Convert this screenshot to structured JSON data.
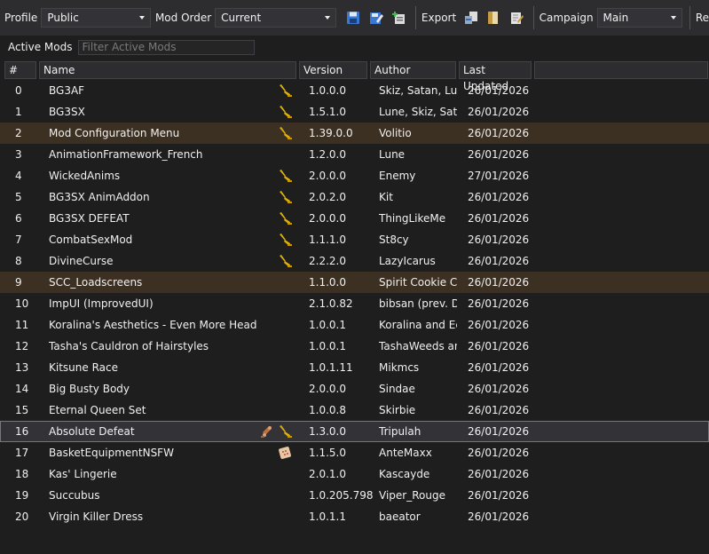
{
  "toolbar": {
    "profile_label": "Profile",
    "profile_value": "Public",
    "modorder_label": "Mod Order",
    "modorder_value": "Current",
    "export_label": "Export",
    "campaign_label": "Campaign",
    "campaign_value": "Main",
    "cutoff_label": "Re"
  },
  "filter": {
    "label": "Active Mods",
    "placeholder": "Filter Active Mods"
  },
  "columns": {
    "idx": "#",
    "name": "Name",
    "version": "Version",
    "author": "Author",
    "updated": "Last Updated"
  },
  "colors": {
    "background": "#1e1e1e",
    "highlight_row": "#3c3022",
    "selected_row": "#333337",
    "wrench_icon": "#e0b000"
  },
  "mods": [
    {
      "idx": "0",
      "name": "BG3AF",
      "version": "1.0.0.0",
      "author": "Skiz, Satan, Lune",
      "updated": "26/01/2026",
      "icons": [
        "wrench-icon"
      ]
    },
    {
      "idx": "1",
      "name": "BG3SX",
      "version": "1.5.1.0",
      "author": "Lune, Skiz, Satan",
      "updated": "26/01/2026",
      "icons": [
        "wrench-icon"
      ]
    },
    {
      "idx": "2",
      "name": "Mod Configuration Menu",
      "version": "1.39.0.0",
      "author": "Volitio",
      "updated": "26/01/2026",
      "icons": [
        "wrench-icon"
      ],
      "highlight": true
    },
    {
      "idx": "3",
      "name": "AnimationFramework_French",
      "version": "1.2.0.0",
      "author": "Lune",
      "updated": "26/01/2026",
      "icons": []
    },
    {
      "idx": "4",
      "name": "WickedAnims",
      "version": "2.0.0.0",
      "author": "Enemy",
      "updated": "27/01/2026",
      "icons": [
        "wrench-icon"
      ]
    },
    {
      "idx": "5",
      "name": "BG3SX AnimAddon",
      "version": "2.0.2.0",
      "author": "Kit",
      "updated": "26/01/2026",
      "icons": [
        "wrench-icon"
      ]
    },
    {
      "idx": "6",
      "name": "BG3SX DEFEAT",
      "version": "2.0.0.0",
      "author": "ThingLikeMe",
      "updated": "26/01/2026",
      "icons": [
        "wrench-icon"
      ]
    },
    {
      "idx": "7",
      "name": "CombatSexMod",
      "version": "1.1.1.0",
      "author": "St8cy",
      "updated": "26/01/2026",
      "icons": [
        "wrench-icon"
      ]
    },
    {
      "idx": "8",
      "name": "DivineCurse",
      "version": "2.2.2.0",
      "author": "LazyIcarus",
      "updated": "26/01/2026",
      "icons": [
        "wrench-icon"
      ]
    },
    {
      "idx": "9",
      "name": "SCC_Loadscreens",
      "version": "1.1.0.0",
      "author": "Spirit Cookie Cake",
      "updated": "26/01/2026",
      "icons": [],
      "highlight": true
    },
    {
      "idx": "10",
      "name": "ImpUI (ImprovedUI)",
      "version": "2.1.0.82",
      "author": "bibsan (prev. Djn)",
      "updated": "26/01/2026",
      "icons": []
    },
    {
      "idx": "11",
      "name": "Koralina's Aesthetics - Even More Heads",
      "version": "1.0.0.1",
      "author": "Koralina and Eclipse",
      "updated": "26/01/2026",
      "icons": []
    },
    {
      "idx": "12",
      "name": "Tasha's Cauldron of Hairstyles",
      "version": "1.0.0.1",
      "author": "TashaWeeds and",
      "updated": "26/01/2026",
      "icons": []
    },
    {
      "idx": "13",
      "name": "Kitsune Race",
      "version": "1.0.1.11",
      "author": "Mikmcs",
      "updated": "26/01/2026",
      "icons": []
    },
    {
      "idx": "14",
      "name": "Big Busty Body",
      "version": "2.0.0.0",
      "author": "Sindae",
      "updated": "26/01/2026",
      "icons": []
    },
    {
      "idx": "15",
      "name": "Eternal Queen Set",
      "version": "1.0.0.8",
      "author": "Skirbie",
      "updated": "26/01/2026",
      "icons": []
    },
    {
      "idx": "16",
      "name": "Absolute Defeat",
      "version": "1.3.0.0",
      "author": "Tripulah",
      "updated": "26/01/2026",
      "icons": [
        "puzzle-icon",
        "wrench-icon"
      ],
      "selected": true
    },
    {
      "idx": "17",
      "name": "BasketEquipmentNSFW",
      "version": "1.1.5.0",
      "author": "AnteMaxx",
      "updated": "26/01/2026",
      "icons": [
        "patch-icon"
      ]
    },
    {
      "idx": "18",
      "name": "Kas' Lingerie",
      "version": "2.0.1.0",
      "author": "Kascayde",
      "updated": "26/01/2026",
      "icons": []
    },
    {
      "idx": "19",
      "name": "Succubus",
      "version": "1.0.205.7982",
      "author": "Viper_Rouge",
      "updated": "26/01/2026",
      "icons": []
    },
    {
      "idx": "20",
      "name": "Virgin Killer Dress",
      "version": "1.0.1.1",
      "author": "baeator",
      "updated": "26/01/2026",
      "icons": []
    }
  ]
}
